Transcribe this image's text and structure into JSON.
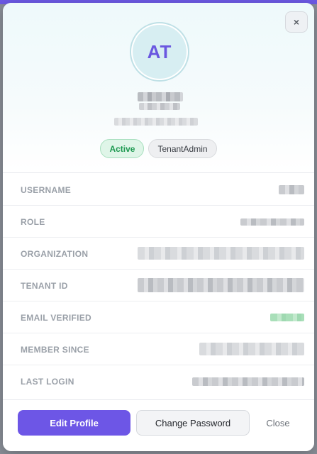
{
  "modal": {
    "close_icon": "×",
    "avatar_initials": "AT",
    "badges": {
      "status": "Active",
      "role": "TenantAdmin"
    },
    "details": [
      {
        "label": "USERNAME"
      },
      {
        "label": "ROLE"
      },
      {
        "label": "ORGANIZATION"
      },
      {
        "label": "TENANT ID"
      },
      {
        "label": "EMAIL VERIFIED"
      },
      {
        "label": "MEMBER SINCE"
      },
      {
        "label": "LAST LOGIN"
      }
    ],
    "actions": {
      "edit_profile": "Edit Profile",
      "change_password": "Change Password",
      "close": "Close"
    }
  },
  "colors": {
    "accent": "#6d56e6",
    "active_badge_text": "#1f9a52",
    "avatar_bg": "#d7eef2"
  }
}
